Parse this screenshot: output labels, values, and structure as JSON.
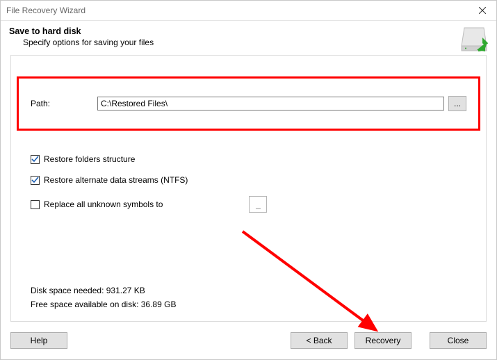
{
  "window": {
    "title": "File Recovery Wizard"
  },
  "header": {
    "title": "Save to hard disk",
    "subtitle": "Specify options for saving your files"
  },
  "path": {
    "label": "Path:",
    "value": "C:\\Restored Files\\",
    "browse_label": "..."
  },
  "options": {
    "restore_folders": {
      "label": "Restore folders structure",
      "checked": true
    },
    "restore_ads": {
      "label": "Restore alternate data streams (NTFS)",
      "checked": true
    },
    "replace_symbols": {
      "label": "Replace all unknown symbols to",
      "checked": false,
      "value": "_"
    }
  },
  "disk": {
    "needed": "Disk space needed: 931.27 KB",
    "free": "Free space available on disk: 36.89 GB"
  },
  "buttons": {
    "help": "Help",
    "back": "< Back",
    "recovery": "Recovery",
    "close": "Close"
  }
}
